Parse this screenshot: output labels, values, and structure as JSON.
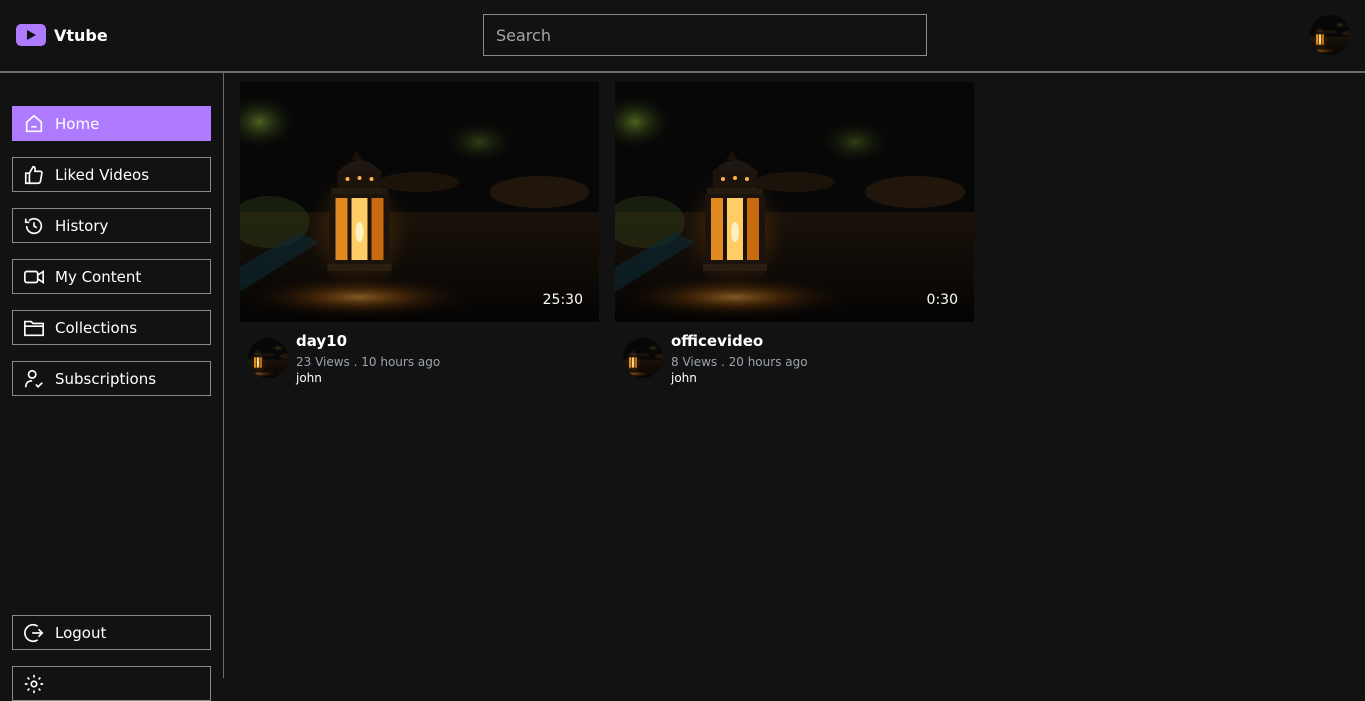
{
  "app": {
    "name": "Vtube"
  },
  "search": {
    "placeholder": "Search"
  },
  "sidebar": {
    "items": [
      {
        "label": "Home",
        "icon": "home-icon",
        "active": true
      },
      {
        "label": "Liked Videos",
        "icon": "thumbs-up-icon"
      },
      {
        "label": "History",
        "icon": "history-icon"
      },
      {
        "label": "My Content",
        "icon": "video-camera-icon"
      },
      {
        "label": "Collections",
        "icon": "folder-icon"
      },
      {
        "label": "Subscriptions",
        "icon": "user-check-icon"
      }
    ],
    "logout_label": "Logout"
  },
  "videos": [
    {
      "title": "day10",
      "stats": "23 Views . 10 hours ago",
      "owner": "john",
      "duration": "25:30"
    },
    {
      "title": "officevideo",
      "stats": "8 Views . 20 hours ago",
      "owner": "john",
      "duration": "0:30"
    }
  ],
  "colors": {
    "accent": "#ae7aff",
    "background": "#121212",
    "border": "#8a8a8a",
    "muted_text": "#9ca3af"
  }
}
